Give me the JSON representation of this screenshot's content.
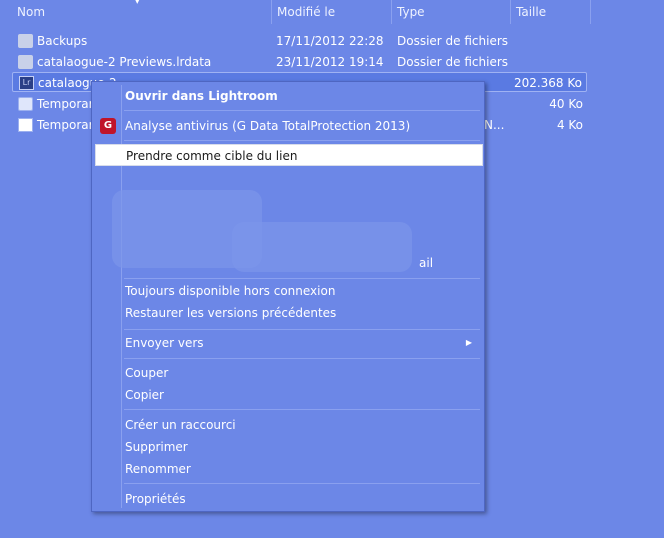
{
  "columns": {
    "name": "Nom",
    "modified": "Modifié le",
    "type": "Type",
    "size": "Taille"
  },
  "files": [
    {
      "name": "Backups",
      "date": "17/11/2012 22:28",
      "type": "Dossier de fichiers",
      "size": "",
      "icon": "folder-icon"
    },
    {
      "name": "catalaogue-2 Previews.lrdata",
      "date": "23/11/2012 19:14",
      "type": "Dossier de fichiers",
      "size": "",
      "icon": "folder-icon"
    },
    {
      "name": "catalaogue-2",
      "date": "",
      "type": "",
      "size": "202.368 Ko",
      "icon": "lightroom-icon"
    },
    {
      "name": "Temporar",
      "date": "",
      "type": "",
      "size": "40 Ko",
      "icon": "gear-file-icon"
    },
    {
      "name": "Temporar",
      "date": "",
      "type": "N...",
      "size": "4 Ko",
      "icon": "doc-icon"
    }
  ],
  "menu": {
    "open": "Ouvrir dans Lightroom",
    "antivirus": "Analyse antivirus (G Data TotalProtection 2013)",
    "antivirus_icon_letter": "G",
    "target": "Prendre comme cible du lien",
    "partial_text": "ail",
    "offline": "Toujours disponible hors connexion",
    "restore": "Restaurer les versions précédentes",
    "send_to": "Envoyer vers",
    "cut": "Couper",
    "copy": "Copier",
    "shortcut": "Créer un raccourci",
    "delete": "Supprimer",
    "rename": "Renommer",
    "properties": "Propriétés"
  },
  "colors": {
    "background": "#6c87e7",
    "highlight": "#ffffff",
    "antivirus": "#c0142a"
  }
}
